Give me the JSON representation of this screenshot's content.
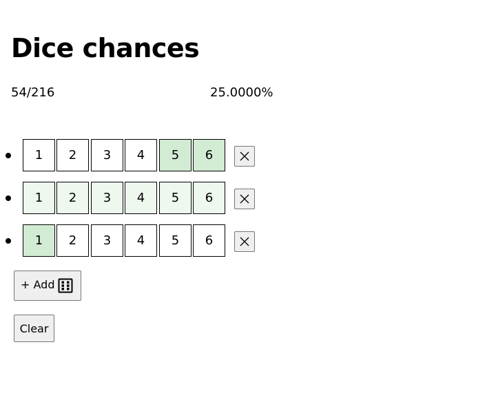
{
  "title": "Dice chances",
  "summary": {
    "fraction": "54/216",
    "percent": "25.0000%"
  },
  "dice": [
    {
      "faces": [
        "1",
        "2",
        "3",
        "4",
        "5",
        "6"
      ],
      "state": [
        "plain",
        "plain",
        "plain",
        "plain",
        "selected",
        "selected"
      ],
      "remove_icon": "close-icon"
    },
    {
      "faces": [
        "1",
        "2",
        "3",
        "4",
        "5",
        "6"
      ],
      "state": [
        "tinted",
        "tinted",
        "tinted",
        "tinted",
        "tinted",
        "tinted"
      ],
      "remove_icon": "close-icon"
    },
    {
      "faces": [
        "1",
        "2",
        "3",
        "4",
        "5",
        "6"
      ],
      "state": [
        "selected",
        "plain",
        "plain",
        "plain",
        "plain",
        "plain"
      ],
      "remove_icon": "close-icon"
    }
  ],
  "buttons": {
    "add_label": "+ Add",
    "add_icon": "dice-six-icon",
    "clear_label": "Clear"
  },
  "colors": {
    "selected": "#d2ecd4",
    "tinted": "#eef8ef",
    "plain": "#ffffff"
  }
}
